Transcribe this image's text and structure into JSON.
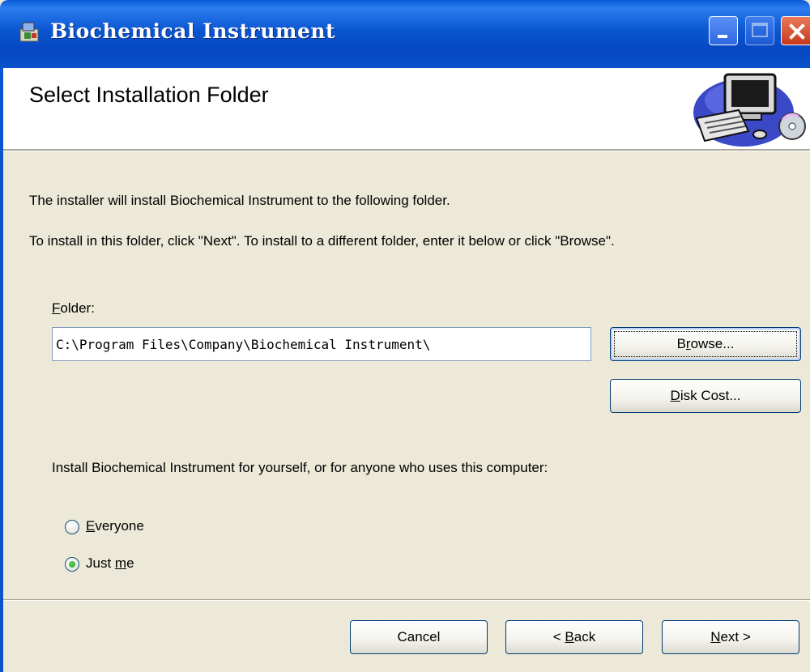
{
  "window": {
    "title": "Biochemical Instrument",
    "icons": [
      "installer-icon",
      "minimize-icon",
      "maximize-icon",
      "close-icon"
    ]
  },
  "header": {
    "heading": "Select Installation Folder",
    "art_icon": "computer-cd-illustration"
  },
  "body": {
    "line1": "The installer will install Biochemical Instrument to the following folder.",
    "line2": "To install in this folder, click \"Next\". To install to a different folder, enter it below or click \"Browse\".",
    "folder_label_mnemonic": "F",
    "folder_label_rest": "older:",
    "folder_value": "C:\\Program Files\\Company\\Biochemical Instrument\\",
    "browse_mnemonic": "r",
    "browse_pre": "B",
    "browse_post": "owse...",
    "disk_mnemonic": "D",
    "disk_rest": "isk Cost...",
    "scope_prompt": "Install Biochemical Instrument for yourself, or for anyone who uses this computer:",
    "radios": [
      {
        "pre": "",
        "mnemonic": "E",
        "rest": "veryone",
        "checked": false
      },
      {
        "pre": "Just ",
        "mnemonic": "m",
        "rest": "e",
        "checked": true
      }
    ]
  },
  "footer": {
    "cancel": "Cancel",
    "back_pre": "< ",
    "back_mnemonic": "B",
    "back_rest": "ack",
    "next_mnemonic": "N",
    "next_rest": "ext >"
  },
  "colors": {
    "titlebar": "#0a56d0",
    "dialog_bg": "#ece9d8",
    "banner_bg": "#ffffff",
    "radio_dot": "#21a121"
  }
}
